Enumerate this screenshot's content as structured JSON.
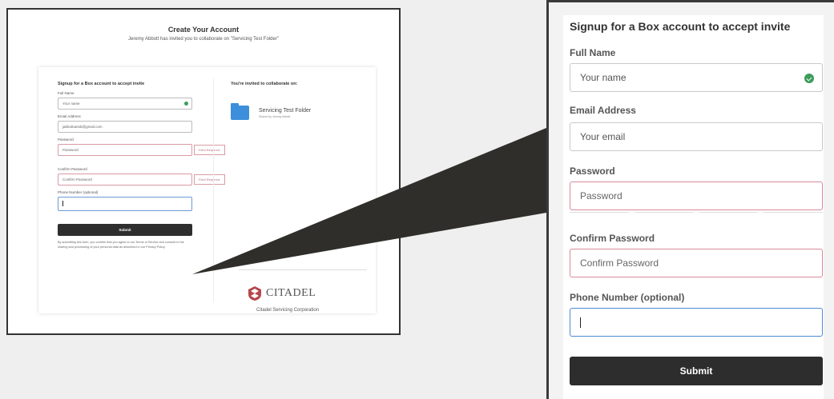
{
  "page": {
    "title": "Create Your Account",
    "subtitle": "Jeremy Abbott has invited you to collaborate on \"Servicing Test Folder\""
  },
  "form": {
    "heading": "Signup for a Box account to accept invite",
    "full_name": {
      "label": "Full Name",
      "placeholder": "Your name",
      "valid_icon": "check-circle-icon"
    },
    "email": {
      "label": "Email Address",
      "placeholder": "Your email",
      "value_small": "jabbottutestt@gmail.com"
    },
    "password": {
      "label": "Password",
      "placeholder": "Password",
      "error": "Field Required."
    },
    "confirm_password": {
      "label": "Confirm Password",
      "placeholder": "Confirm Password",
      "error": "Field Required."
    },
    "phone": {
      "label": "Phone Number (optional)",
      "value": ""
    },
    "submit_label": "Submit",
    "terms_text": "By submitting this form, you confirm that you agree to our Terms of Service and consent to the sharing and processing of your personal data as described in our Privacy Policy."
  },
  "invite": {
    "heading": "You're invited to collaborate on:",
    "folder_name": "Servicing Test Folder",
    "shared_by": "Shared by Jeremy Abbott",
    "folder_icon": "folder-icon"
  },
  "brand": {
    "logo_word": "CITADEL",
    "company": "Citadel Servicing Corporation",
    "logo_icon": "citadel-shield-icon"
  },
  "colors": {
    "error_border": "#d88a98",
    "focus_border": "#4e8ad6",
    "valid_green": "#3c9c5a",
    "submit_bg": "#2d2d2d",
    "frame": "#3a3a3a"
  }
}
